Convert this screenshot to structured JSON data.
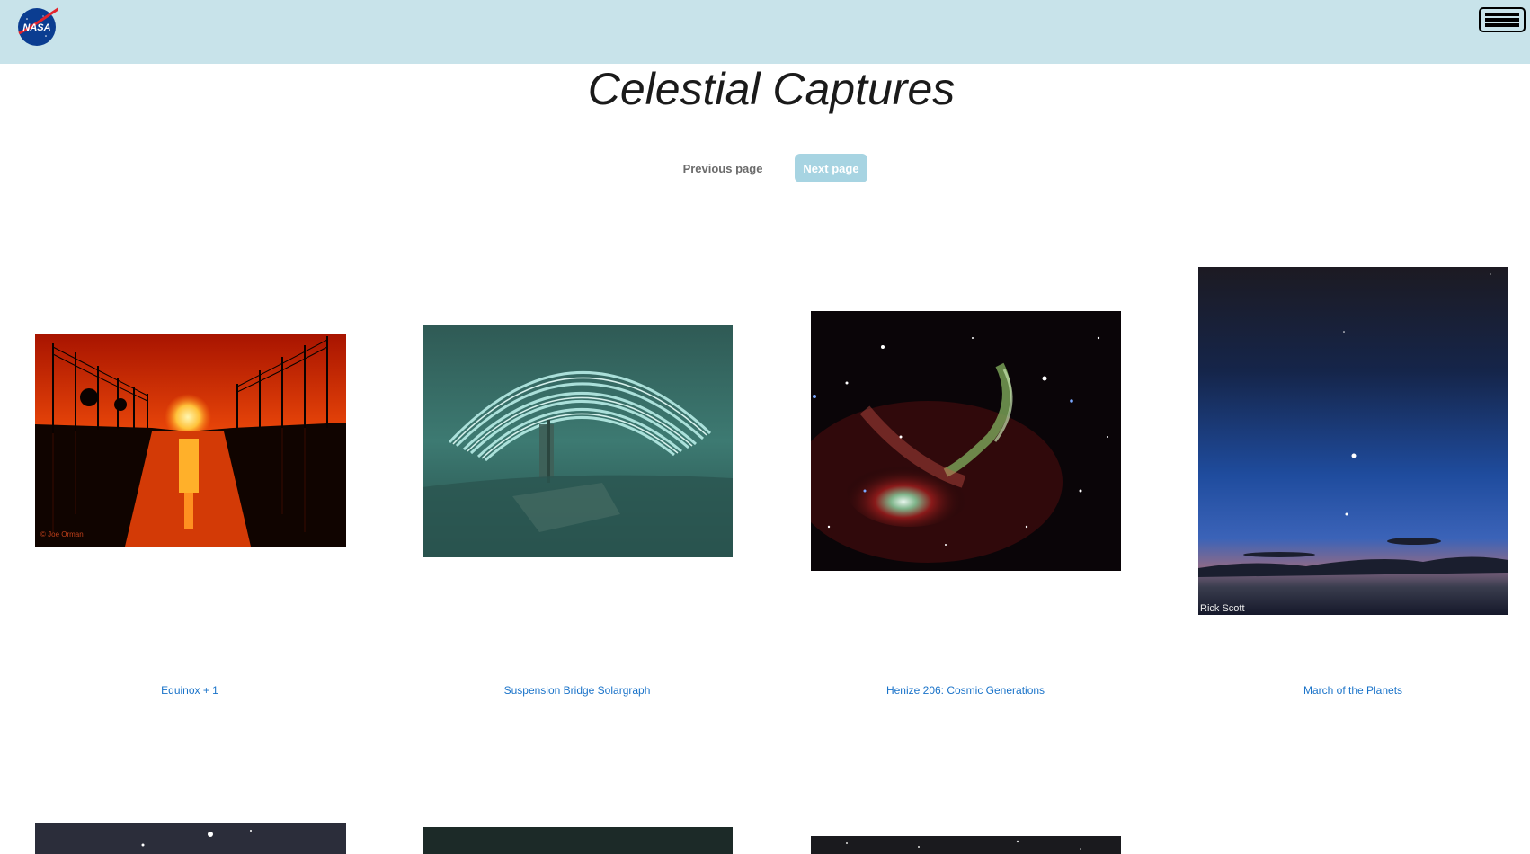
{
  "header": {
    "logo_text": "NASA",
    "menu_icon": "hamburger-menu-icon",
    "background_color": "#c8e3ea"
  },
  "page": {
    "title": "Celestial Captures"
  },
  "pagination": {
    "previous_label": "Previous page",
    "next_label": "Next page",
    "next_color": "#a7d4e2"
  },
  "gallery": {
    "link_color": "#1a73c9",
    "items": [
      {
        "caption": "Equinox + 1",
        "credit": "© Joe Orman"
      },
      {
        "caption": "Suspension Bridge Solargraph"
      },
      {
        "caption": "Henize 206: Cosmic Generations"
      },
      {
        "caption": "March of the Planets",
        "credit": "Rick Scott"
      }
    ]
  }
}
